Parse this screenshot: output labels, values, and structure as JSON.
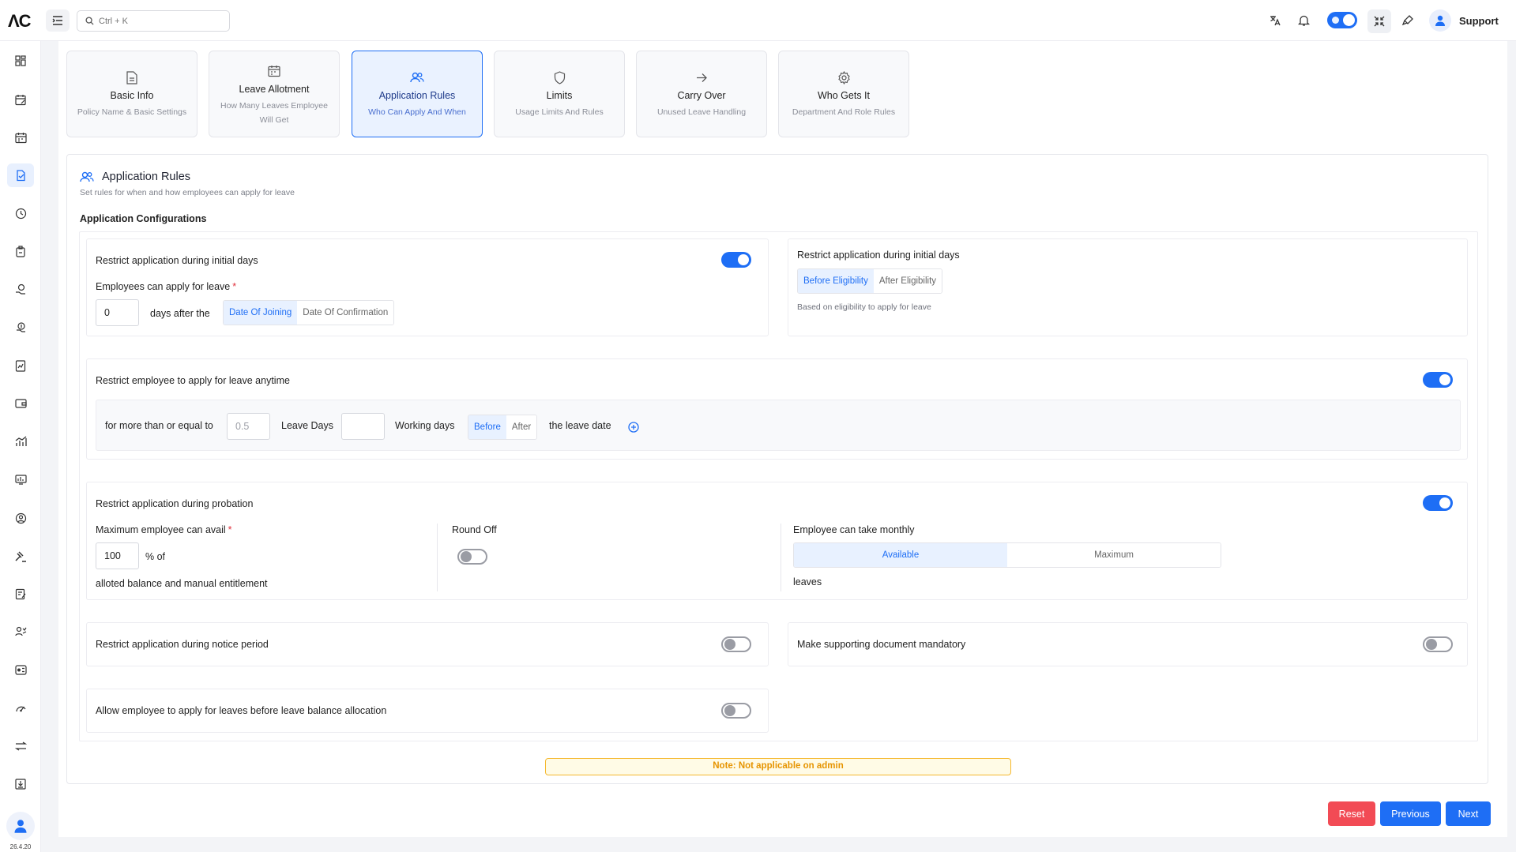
{
  "header": {
    "logo": "ΛC",
    "search_placeholder": "Ctrl + K",
    "user_label": "Support"
  },
  "sidebar": {
    "version": "26.4.20",
    "items": [
      "dashboard-icon",
      "calendar-edit-icon",
      "calendar-icon",
      "leave-icon",
      "clock-icon",
      "badge-icon",
      "hand-money-icon",
      "coins-icon",
      "report-icon",
      "wallet-icon",
      "chart-icon",
      "analytics-icon",
      "user-circle-icon",
      "gavel-icon",
      "form-icon",
      "team-icon",
      "toggle-card-icon",
      "speed-icon",
      "transfer-icon",
      "download-box-icon"
    ]
  },
  "steps": [
    {
      "title": "Basic Info",
      "subtitle": "Policy Name & Basic Settings",
      "icon": "document-icon"
    },
    {
      "title": "Leave Allotment",
      "subtitle": "How Many Leaves Employee Will Get",
      "icon": "calendar-icon"
    },
    {
      "title": "Application Rules",
      "subtitle": "Who Can Apply And When",
      "icon": "users-icon"
    },
    {
      "title": "Limits",
      "subtitle": "Usage Limits And Rules",
      "icon": "shield-icon"
    },
    {
      "title": "Carry Over",
      "subtitle": "Unused Leave Handling",
      "icon": "arrow-right-icon"
    },
    {
      "title": "Who Gets It",
      "subtitle": "Department And Role Rules",
      "icon": "gear-icon"
    }
  ],
  "section": {
    "title": "Application Rules",
    "subtitle": "Set rules for when and how employees can apply for leave",
    "config_title": "Application Configurations"
  },
  "initial_days": {
    "label": "Restrict application during initial days",
    "apply_label": "Employees can apply for leave",
    "days_value": "0",
    "after_text": "days after the",
    "opt_joining": "Date Of Joining",
    "opt_confirmation": "Date Of Confirmation"
  },
  "eligibility": {
    "label": "Restrict application during initial days",
    "opt_before": "Before Eligibility",
    "opt_after": "After Eligibility",
    "hint": "Based on eligibility to apply for leave"
  },
  "anytime": {
    "label": "Restrict employee to apply for leave anytime",
    "more_text": "for more than or equal to",
    "leave_days_placeholder": "0.5",
    "leave_days_text": "Leave Days",
    "working_days_text": "Working days",
    "opt_before": "Before",
    "opt_after": "After",
    "tail_text": "the leave date"
  },
  "probation": {
    "label": "Restrict application during probation",
    "max_label": "Maximum employee can avail",
    "max_value": "100",
    "percent_text": "% of",
    "balance_text": "alloted balance and manual entitlement",
    "round_off": "Round Off",
    "monthly_label": "Employee can take monthly",
    "opt_available": "Available",
    "opt_maximum": "Maximum",
    "leaves_text": "leaves"
  },
  "notice": {
    "label": "Restrict application during notice period"
  },
  "document": {
    "label": "Make supporting document mandatory"
  },
  "before_alloc": {
    "label": "Allow employee to apply for leaves before leave balance allocation"
  },
  "note": "Note: Not applicable on admin",
  "buttons": {
    "reset": "Reset",
    "previous": "Previous",
    "next": "Next"
  },
  "colors": {
    "accent": "#1e6ef5",
    "danger": "#f24b55",
    "warning": "#f5b82e"
  }
}
